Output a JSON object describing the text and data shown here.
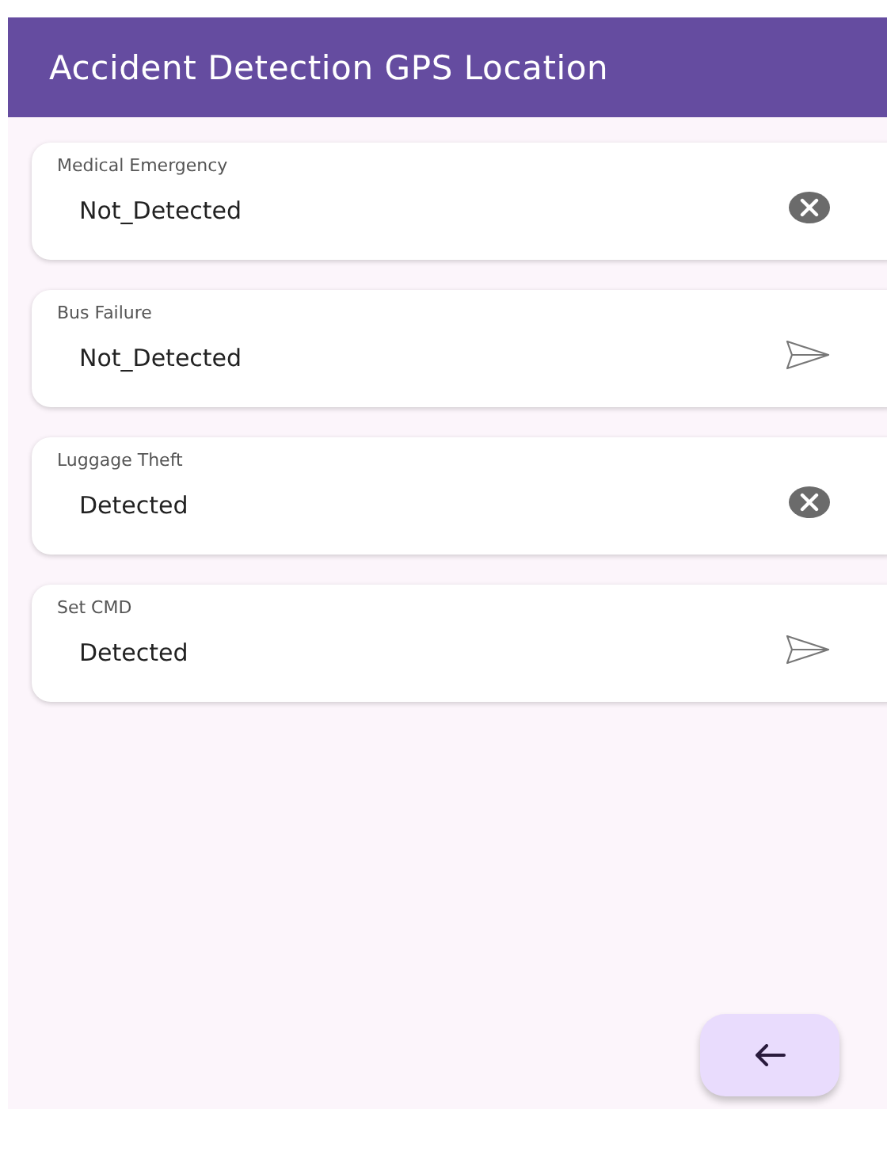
{
  "app_bar": {
    "title": "Accident Detection GPS Location"
  },
  "cards": [
    {
      "label": "Medical Emergency",
      "value": "Not_Detected",
      "kind": "clear"
    },
    {
      "label": "Bus Failure",
      "value": "Not_Detected",
      "kind": "send"
    },
    {
      "label": "Luggage Theft",
      "value": "Detected",
      "kind": "clear"
    },
    {
      "label": "Set CMD",
      "value": "Detected",
      "kind": "send"
    }
  ]
}
